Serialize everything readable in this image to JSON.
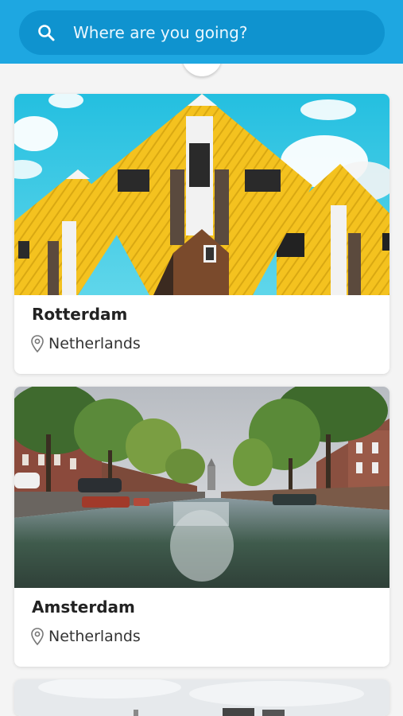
{
  "search": {
    "placeholder": "Where are you going?",
    "icon": "search-icon"
  },
  "destinations": [
    {
      "city": "Rotterdam",
      "country": "Netherlands"
    },
    {
      "city": "Amsterdam",
      "country": "Netherlands"
    },
    {
      "city": "",
      "country": ""
    }
  ],
  "colors": {
    "header": "#1ea7e1",
    "search_pill": "#0f93cf",
    "background": "#f4f4f4"
  }
}
